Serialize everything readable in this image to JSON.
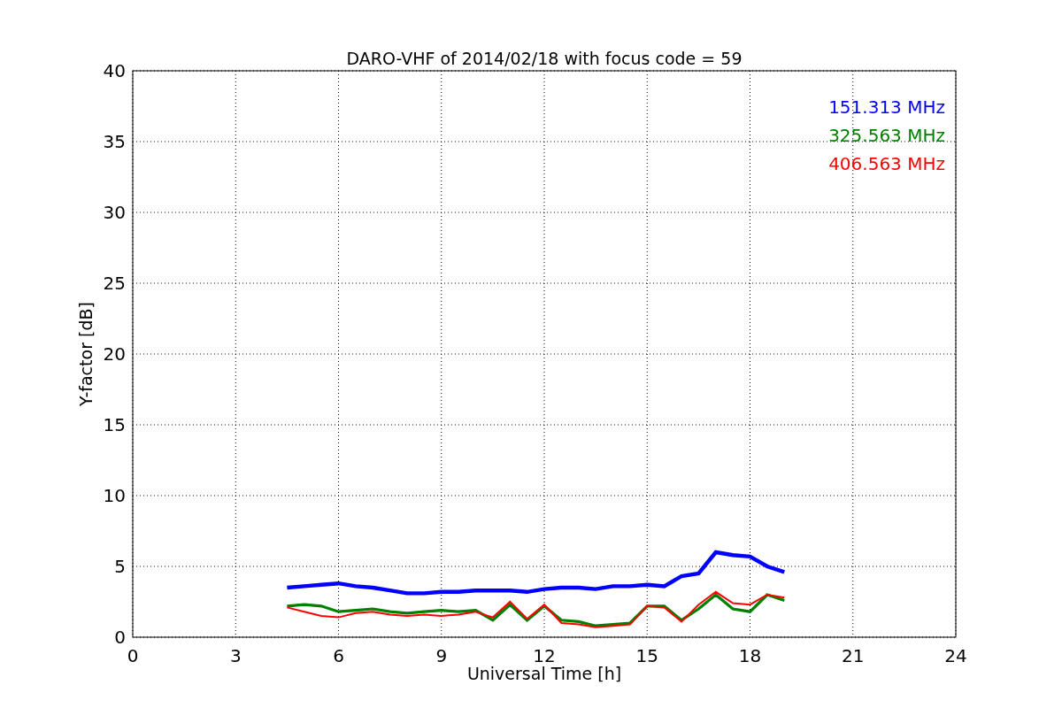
{
  "chart_data": {
    "type": "line",
    "title": "DARO-VHF of 2014/02/18 with focus code = 59",
    "xlabel": "Universal Time [h]",
    "ylabel": "Y-factor [dB]",
    "x": [
      4.5,
      5,
      5.5,
      6,
      6.5,
      7,
      7.5,
      8,
      8.5,
      9,
      9.5,
      10,
      10.5,
      11,
      11.5,
      12,
      12.5,
      13,
      13.5,
      14,
      14.5,
      15,
      15.5,
      16,
      16.5,
      17,
      17.5,
      18,
      18.5,
      19
    ],
    "series": [
      {
        "name": "151.313 MHz",
        "color": "#0000ff",
        "values": [
          3.5,
          3.6,
          3.7,
          3.8,
          3.6,
          3.5,
          3.3,
          3.1,
          3.1,
          3.2,
          3.2,
          3.3,
          3.3,
          3.3,
          3.2,
          3.4,
          3.5,
          3.5,
          3.4,
          3.6,
          3.6,
          3.7,
          3.6,
          4.3,
          4.5,
          6.0,
          5.8,
          5.7,
          5.0,
          4.6
        ]
      },
      {
        "name": "325.563 MHz",
        "color": "#008000",
        "values": [
          2.2,
          2.3,
          2.2,
          1.8,
          1.9,
          2.0,
          1.8,
          1.7,
          1.8,
          1.9,
          1.8,
          1.9,
          1.2,
          2.3,
          1.2,
          2.2,
          1.2,
          1.1,
          0.8,
          0.9,
          1.0,
          2.2,
          2.2,
          1.2,
          2.0,
          3.0,
          2.0,
          1.8,
          3.0,
          2.6
        ]
      },
      {
        "name": "406.563 MHz",
        "color": "#ff0000",
        "values": [
          2.1,
          1.8,
          1.5,
          1.4,
          1.7,
          1.8,
          1.6,
          1.5,
          1.6,
          1.5,
          1.6,
          1.8,
          1.4,
          2.5,
          1.3,
          2.3,
          1.0,
          0.9,
          0.7,
          0.8,
          0.9,
          2.2,
          2.1,
          1.1,
          2.3,
          3.2,
          2.4,
          2.3,
          3.0,
          2.8
        ]
      }
    ],
    "xlim": [
      0,
      24
    ],
    "ylim": [
      0,
      40
    ],
    "xticks": [
      0,
      3,
      6,
      9,
      12,
      15,
      18,
      21,
      24
    ],
    "yticks": [
      0,
      5,
      10,
      15,
      20,
      25,
      30,
      35,
      40
    ],
    "grid": true
  }
}
